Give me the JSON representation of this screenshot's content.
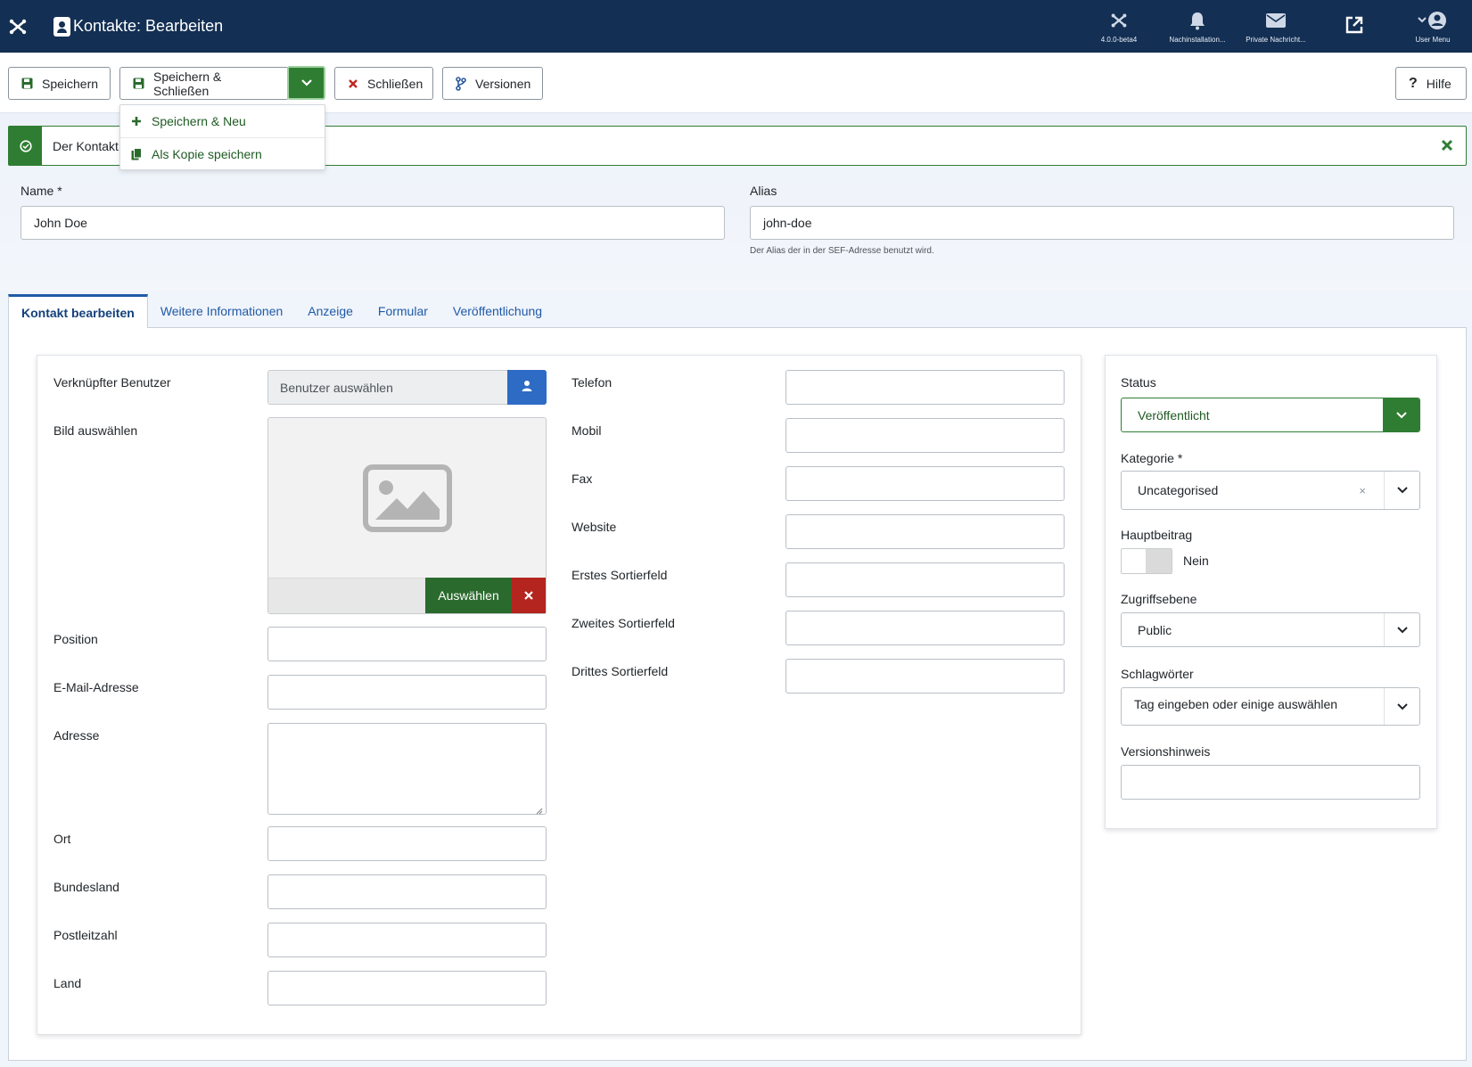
{
  "header": {
    "title": "Kontakte: Bearbeiten",
    "status_items": [
      {
        "icon": "joomla-icon",
        "label": "4.0.0-beta4"
      },
      {
        "icon": "bell-icon",
        "label": "Nachinstallation..."
      },
      {
        "icon": "envelope-icon",
        "label": "Private Nachricht..."
      },
      {
        "icon": "external-link-icon",
        "label": ""
      },
      {
        "icon": "user-icon",
        "label": "User Menu"
      }
    ]
  },
  "toolbar": {
    "save": "Speichern",
    "save_close": "Speichern & Schließen",
    "close": "Schließen",
    "versions": "Versionen",
    "help": "Hilfe",
    "dropdown": {
      "save_new": "Speichern & Neu",
      "save_copy": "Als Kopie speichern"
    }
  },
  "alert": {
    "text": "Der Kontakt"
  },
  "title_fields": {
    "name_label": "Name *",
    "name_value": "John Doe",
    "alias_label": "Alias",
    "alias_value": "john-doe",
    "alias_hint": "Der Alias der in der SEF-Adresse benutzt wird."
  },
  "tabs": [
    {
      "label": "Kontakt bearbeiten",
      "active": true
    },
    {
      "label": "Weitere Informationen",
      "active": false
    },
    {
      "label": "Anzeige",
      "active": false
    },
    {
      "label": "Formular",
      "active": false
    },
    {
      "label": "Veröffentlichung",
      "active": false
    }
  ],
  "left_column": {
    "linked_user_label": "Verknüpfter Benutzer",
    "linked_user_placeholder": "Benutzer auswählen",
    "image_label": "Bild auswählen",
    "image_select": "Auswählen",
    "position": "Position",
    "email": "E-Mail-Adresse",
    "address": "Adresse",
    "city": "Ort",
    "state": "Bundesland",
    "zip": "Postleitzahl",
    "country": "Land"
  },
  "middle_column": {
    "phone": "Telefon",
    "mobile": "Mobil",
    "fax": "Fax",
    "website": "Website",
    "sort1": "Erstes Sortierfeld",
    "sort2": "Zweites Sortierfeld",
    "sort3": "Drittes Sortierfeld"
  },
  "sidebar": {
    "status_label": "Status",
    "status_value": "Veröffentlicht",
    "category_label": "Kategorie *",
    "category_value": "Uncategorised",
    "category_clear": "×",
    "featured_label": "Hauptbeitrag",
    "featured_value": "Nein",
    "access_label": "Zugriffsebene",
    "access_value": "Public",
    "tags_label": "Schlagwörter",
    "tags_placeholder": "Tag eingeben oder einige auswählen",
    "version_note_label": "Versionshinweis"
  },
  "colors": {
    "header_bg": "#132f53",
    "success": "#2f7d32",
    "primary": "#2d6bc4",
    "danger": "#b3251e"
  }
}
